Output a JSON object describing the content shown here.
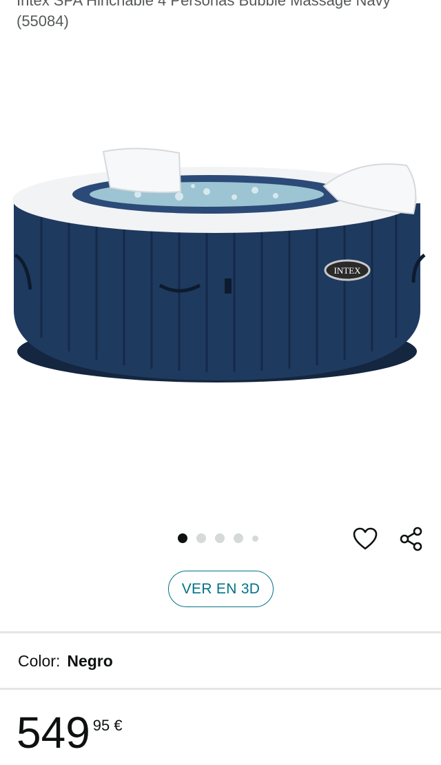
{
  "product": {
    "title": "Intex SPA Hinchable 4 Personas Bubble Massage Navy (55084)",
    "image_brand_label": "INTEX"
  },
  "gallery": {
    "image_count": 5,
    "active_index": 0
  },
  "actions": {
    "view_3d_label": "VER EN 3D"
  },
  "variant": {
    "label": "Color:",
    "value": "Negro"
  },
  "price": {
    "whole": "549",
    "fraction": "95",
    "currency": "€"
  },
  "colors": {
    "accent": "#007185",
    "spa_navy": "#1d3557",
    "spa_white": "#f3f4f6"
  }
}
